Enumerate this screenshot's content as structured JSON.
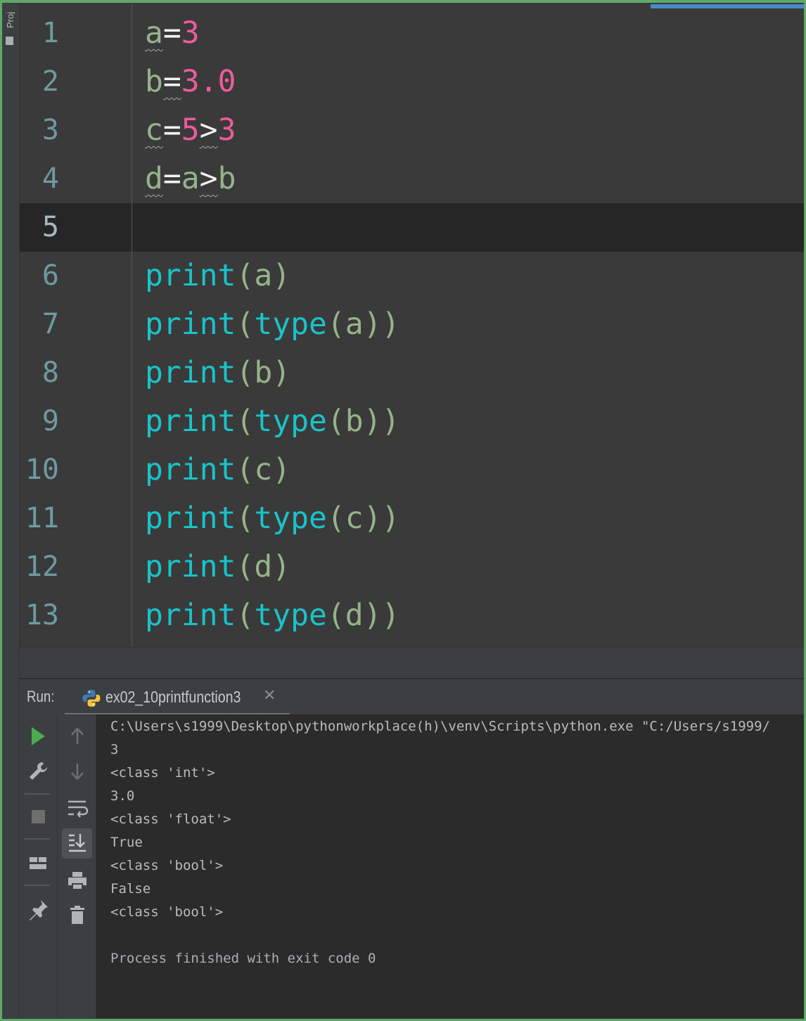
{
  "project_panel": {
    "label": "Proj"
  },
  "editor": {
    "current_line": 5,
    "lines": [
      {
        "n": "1",
        "tokens": [
          [
            "id",
            "a",
            true
          ],
          [
            "op",
            "=",
            false
          ],
          [
            "num",
            "3",
            false
          ]
        ]
      },
      {
        "n": "2",
        "tokens": [
          [
            "id",
            "b",
            false
          ],
          [
            "op",
            "=",
            true
          ],
          [
            "num",
            "3.0",
            false
          ]
        ]
      },
      {
        "n": "3",
        "tokens": [
          [
            "id",
            "c",
            true
          ],
          [
            "op",
            "=",
            false
          ],
          [
            "num",
            "5",
            false
          ],
          [
            "op",
            ">",
            true
          ],
          [
            "num",
            "3",
            false
          ]
        ]
      },
      {
        "n": "4",
        "tokens": [
          [
            "id",
            "d",
            true
          ],
          [
            "op",
            "=",
            false
          ],
          [
            "id",
            "a",
            false
          ],
          [
            "op",
            ">",
            true
          ],
          [
            "id",
            "b",
            false
          ]
        ]
      },
      {
        "n": "5",
        "tokens": []
      },
      {
        "n": "6",
        "tokens": [
          [
            "fn",
            "print",
            false
          ],
          [
            "par",
            "(",
            false
          ],
          [
            "id",
            "a",
            false
          ],
          [
            "par",
            ")",
            false
          ]
        ]
      },
      {
        "n": "7",
        "tokens": [
          [
            "fn",
            "print",
            false
          ],
          [
            "par",
            "(",
            false
          ],
          [
            "fn",
            "type",
            false
          ],
          [
            "par",
            "(",
            false
          ],
          [
            "id",
            "a",
            false
          ],
          [
            "par",
            "))",
            false
          ]
        ]
      },
      {
        "n": "8",
        "tokens": [
          [
            "fn",
            "print",
            false
          ],
          [
            "par",
            "(",
            false
          ],
          [
            "id",
            "b",
            false
          ],
          [
            "par",
            ")",
            false
          ]
        ]
      },
      {
        "n": "9",
        "tokens": [
          [
            "fn",
            "print",
            false
          ],
          [
            "par",
            "(",
            false
          ],
          [
            "fn",
            "type",
            false
          ],
          [
            "par",
            "(",
            false
          ],
          [
            "id",
            "b",
            false
          ],
          [
            "par",
            "))",
            false
          ]
        ]
      },
      {
        "n": "10",
        "tokens": [
          [
            "fn",
            "print",
            false
          ],
          [
            "par",
            "(",
            false
          ],
          [
            "id",
            "c",
            false
          ],
          [
            "par",
            ")",
            false
          ]
        ]
      },
      {
        "n": "11",
        "tokens": [
          [
            "fn",
            "print",
            false
          ],
          [
            "par",
            "(",
            false
          ],
          [
            "fn",
            "type",
            false
          ],
          [
            "par",
            "(",
            false
          ],
          [
            "id",
            "c",
            false
          ],
          [
            "par",
            "))",
            false
          ]
        ]
      },
      {
        "n": "12",
        "tokens": [
          [
            "fn",
            "print",
            false
          ],
          [
            "par",
            "(",
            false
          ],
          [
            "id",
            "d",
            false
          ],
          [
            "par",
            ")",
            false
          ]
        ]
      },
      {
        "n": "13",
        "tokens": [
          [
            "fn",
            "print",
            false
          ],
          [
            "par",
            "(",
            false
          ],
          [
            "fn",
            "type",
            false
          ],
          [
            "par",
            "(",
            false
          ],
          [
            "id",
            "d",
            false
          ],
          [
            "par",
            "))",
            false
          ]
        ]
      }
    ]
  },
  "run": {
    "label": "Run:",
    "tab_name": "ex02_10printfunction3",
    "close_glyph": "✕",
    "output": [
      "C:\\Users\\s1999\\Desktop\\pythonworkplace(h)\\venv\\Scripts\\python.exe \"C:/Users/s1999/",
      "3",
      "<class 'int'>",
      "3.0",
      "<class 'float'>",
      "True",
      "<class 'bool'>",
      "False",
      "<class 'bool'>",
      "",
      "Process finished with exit code 0"
    ],
    "toolbar_left": [
      "run-icon",
      "wrench-icon",
      "stop-icon",
      "layout-icon",
      "pin-icon"
    ],
    "toolbar_right": [
      "arrow-up-icon",
      "arrow-down-icon",
      "soft-wrap-icon",
      "scroll-to-end-icon",
      "print-icon",
      "trash-icon"
    ]
  },
  "colors": {
    "accent_green": "#5fa86a",
    "keyword_cyan": "#19c3c9",
    "number_pink": "#ee5b9e",
    "identifier_green": "#95b38a"
  }
}
